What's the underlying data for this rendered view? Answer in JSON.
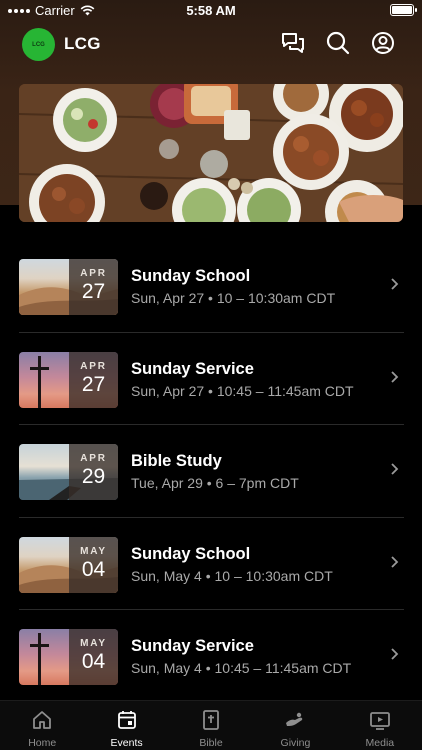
{
  "status_bar": {
    "carrier": "Carrier",
    "time": "5:58 AM"
  },
  "header": {
    "logo_text": "LCG",
    "app_title": "LCG",
    "icons": [
      "chat-bubbles-icon",
      "search-icon",
      "profile-icon"
    ]
  },
  "events": [
    {
      "title": "Sunday School",
      "month": "APR",
      "day": "27",
      "time": "Sun, Apr 27 • 10 – 10:30am CDT",
      "thumb": "desert"
    },
    {
      "title": "Sunday Service",
      "month": "APR",
      "day": "27",
      "time": "Sun, Apr 27 • 10:45 – 11:45am CDT",
      "thumb": "cross"
    },
    {
      "title": "Bible Study",
      "month": "APR",
      "day": "29",
      "time": "Tue, Apr 29 • 6 – 7pm CDT",
      "thumb": "lake"
    },
    {
      "title": "Sunday School",
      "month": "MAY",
      "day": "04",
      "time": "Sun, May 4 • 10 – 10:30am CDT",
      "thumb": "desert"
    },
    {
      "title": "Sunday Service",
      "month": "MAY",
      "day": "04",
      "time": "Sun, May 4 • 10:45 – 11:45am CDT",
      "thumb": "cross"
    }
  ],
  "tabs": [
    {
      "label": "Home",
      "icon": "home-icon",
      "active": false
    },
    {
      "label": "Events",
      "icon": "calendar-icon",
      "active": true
    },
    {
      "label": "Bible",
      "icon": "bible-icon",
      "active": false
    },
    {
      "label": "Giving",
      "icon": "giving-hand-icon",
      "active": false
    },
    {
      "label": "Media",
      "icon": "media-play-icon",
      "active": false
    }
  ],
  "colors": {
    "logo_green": "#27b534",
    "background": "#000000",
    "header_brown": "#3a2416"
  }
}
